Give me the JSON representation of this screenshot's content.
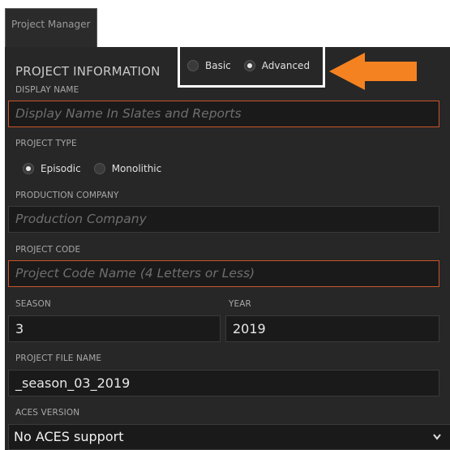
{
  "tab": {
    "label": "Project Manager"
  },
  "section_title": "PROJECT INFORMATION",
  "mode": {
    "basic": "Basic",
    "advanced": "Advanced",
    "selected": "Advanced"
  },
  "display_name": {
    "label": "DISPLAY NAME",
    "placeholder": "Display Name In Slates and Reports"
  },
  "project_type": {
    "label": "PROJECT TYPE",
    "episodic": "Episodic",
    "monolithic": "Monolithic",
    "selected": "Episodic"
  },
  "production_company": {
    "label": "PRODUCTION COMPANY",
    "placeholder": "Production Company"
  },
  "project_code": {
    "label": "PROJECT CODE",
    "placeholder": "Project Code Name (4 Letters or Less)"
  },
  "season": {
    "label": "SEASON",
    "value": "3"
  },
  "year": {
    "label": "YEAR",
    "value": "2019"
  },
  "project_file_name": {
    "label": "PROJECT FILE NAME",
    "value": "_season_03_2019"
  },
  "aces_version": {
    "label": "ACES VERSION",
    "value": "No ACES support"
  },
  "colors": {
    "accent_required": "#c8552a",
    "arrow": "#f58220",
    "highlight_box": "#ffffff"
  }
}
